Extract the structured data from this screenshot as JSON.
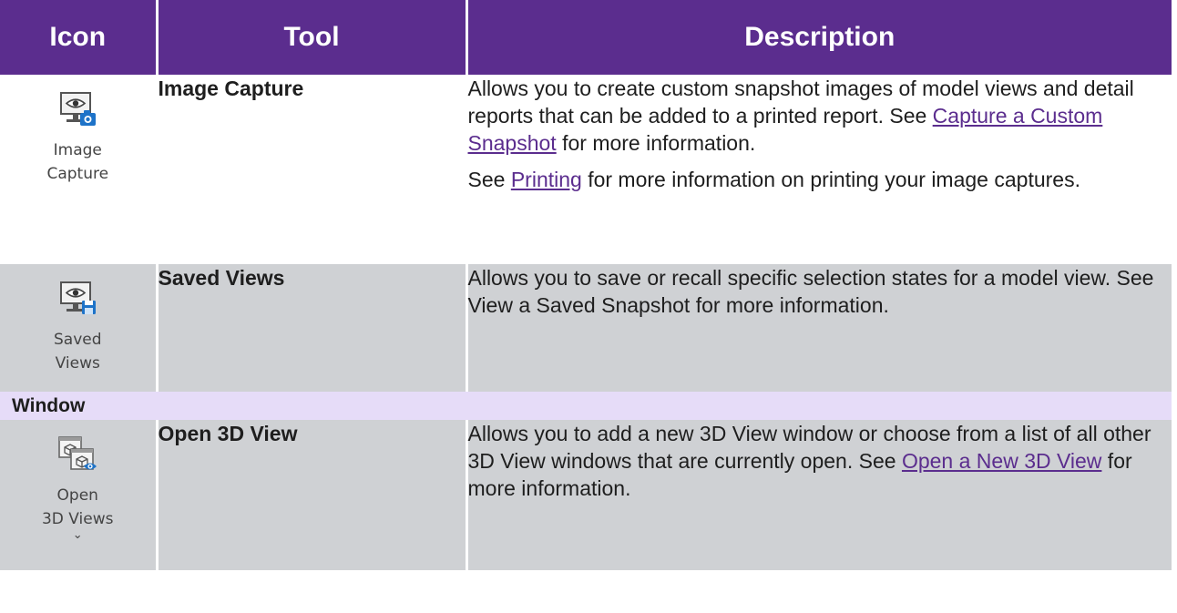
{
  "header": {
    "icon": "Icon",
    "tool": "Tool",
    "description": "Description"
  },
  "rows": [
    {
      "icon_label_1": "Image",
      "icon_label_2": "Capture",
      "icon": "image-capture-icon",
      "tool": "Image Capture",
      "desc_p1_a": "Allows you to create custom snapshot images of model views and detail reports that can be added to a printed report. See ",
      "desc_p1_link": "Capture a Custom Snapshot",
      "desc_p1_b": " for more information.",
      "desc_p2_a": "See ",
      "desc_p2_link": "Printing",
      "desc_p2_b": " for more information on printing your image captures."
    },
    {
      "icon_label_1": "Saved",
      "icon_label_2": "Views",
      "icon": "saved-views-icon",
      "tool": "Saved Views",
      "desc": "Allows you to save or recall specific selection states for a model view. See View a Saved Snapshot for more information."
    }
  ],
  "section": {
    "label": "Window"
  },
  "rows2": [
    {
      "icon_label_1": "Open",
      "icon_label_2": "3D Views",
      "icon": "open-3d-views-icon",
      "tool": "Open 3D View",
      "desc_a": "Allows you to add a new 3D View window or choose from a list of all other 3D View windows that are currently open. See ",
      "desc_link": "Open a New 3D View",
      "desc_b": " for more information."
    }
  ],
  "colors": {
    "header_bg": "#5b2d8e",
    "row_grey": "#cfd1d4",
    "section_bg": "#e6dcf8",
    "link": "#5b2d8e",
    "icon_blue": "#1e73c8"
  }
}
